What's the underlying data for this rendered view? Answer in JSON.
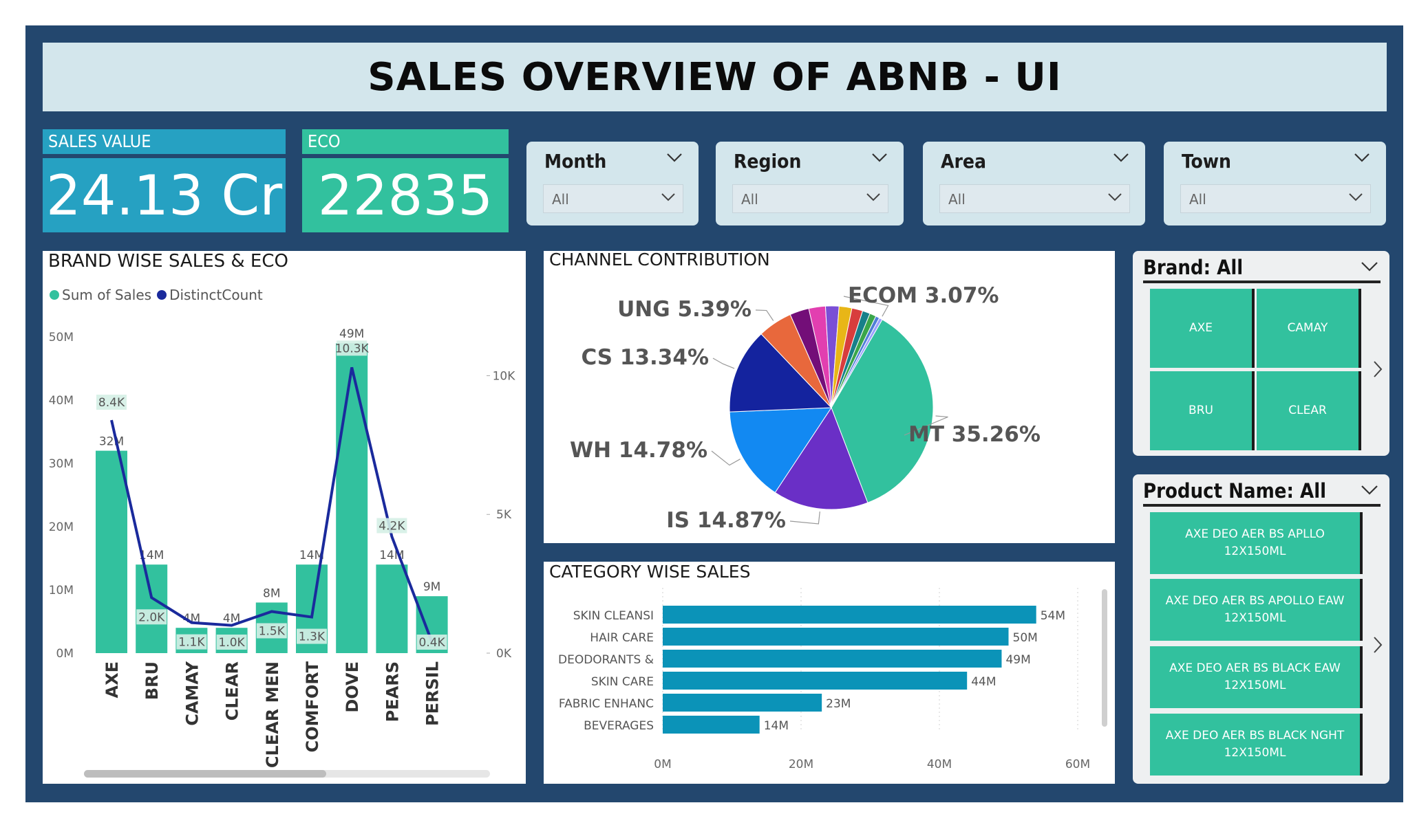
{
  "title": "SALES OVERVIEW OF ABNB - UI",
  "kpis": {
    "sales_label": "SALES VALUE",
    "sales_value": "24.13 Cr",
    "eco_label": "ECO",
    "eco_value": "22835"
  },
  "slicers": [
    {
      "label": "Month",
      "value": "All"
    },
    {
      "label": "Region",
      "value": "All"
    },
    {
      "label": "Area",
      "value": "All"
    },
    {
      "label": "Town",
      "value": "All"
    }
  ],
  "colors": {
    "frame": "#23476e",
    "teal": "#32c19e",
    "navy": "#1a2a9c",
    "kpi_blue": "#26a1c2",
    "bar_blue": "#0b93b8"
  },
  "brand_panel": {
    "title": "Brand: All",
    "tiles": [
      "AXE",
      "CAMAY",
      "BRU",
      "CLEAR"
    ]
  },
  "product_panel": {
    "title": "Product Name: All",
    "tiles": [
      [
        "AXE DEO AER BS APLLO",
        "12X150ML"
      ],
      [
        "AXE DEO AER BS APOLLO EAW",
        "12X150ML"
      ],
      [
        "AXE DEO AER BS BLACK EAW",
        "12X150ML"
      ],
      [
        "AXE DEO AER BS BLACK NGHT",
        "12X150ML"
      ]
    ]
  },
  "chart_data": [
    {
      "id": "brand",
      "type": "bar",
      "title": "BRAND WISE SALES & ECO",
      "legend": [
        "Sum of Sales",
        "DistinctCount"
      ],
      "legend_position": "top-left",
      "categories": [
        "AXE",
        "BRU",
        "CAMAY",
        "CLEAR",
        "CLEAR MEN",
        "COMFORT",
        "DOVE",
        "PEARS",
        "PERSIL"
      ],
      "series": [
        {
          "name": "Sum of Sales",
          "kind": "bar",
          "axis": "left",
          "color": "#32c19e",
          "values": [
            32,
            14,
            4,
            4,
            8,
            14,
            49,
            14,
            9
          ],
          "labels": [
            "32M",
            "14M",
            "4M",
            "4M",
            "8M",
            "14M",
            "49M",
            "14M",
            "9M"
          ]
        },
        {
          "name": "DistinctCount",
          "kind": "line",
          "axis": "right",
          "color": "#1a2a9c",
          "values": [
            8.4,
            2.0,
            1.1,
            1.0,
            1.5,
            1.3,
            10.3,
            4.2,
            0.4
          ],
          "labels": [
            "8.4K",
            "2.0K",
            "1.1K",
            "1.0K",
            "1.5K",
            "1.3K",
            "10.3K",
            "4.2K",
            "0.4K"
          ]
        }
      ],
      "y_left": {
        "ticks": [
          "0M",
          "10M",
          "20M",
          "30M",
          "40M",
          "50M"
        ],
        "range": [
          0,
          50
        ]
      },
      "y_right": {
        "ticks": [
          "0K",
          "5K",
          "10K"
        ],
        "range": [
          0,
          11.4
        ]
      },
      "grid": false
    },
    {
      "id": "channel",
      "type": "pie",
      "title": "CHANNEL CONTRIBUTION",
      "slices": [
        {
          "label": "MT 35.26%",
          "value": 35.26,
          "color": "#32c19e",
          "show": true
        },
        {
          "label": "IS 14.87%",
          "value": 14.87,
          "color": "#6a2fc6",
          "show": true
        },
        {
          "label": "WH 14.78%",
          "value": 14.78,
          "color": "#1289f2",
          "show": true
        },
        {
          "label": "CS 13.34%",
          "value": 13.34,
          "color": "#14239e",
          "show": true
        },
        {
          "label": "UNG 5.39%",
          "value": 5.39,
          "color": "#e8683c",
          "show": true
        },
        {
          "label": "",
          "value": 3.0,
          "color": "#730e78",
          "show": false
        },
        {
          "label": "",
          "value": 2.6,
          "color": "#e23fb0",
          "show": false
        },
        {
          "label": "",
          "value": 2.1,
          "color": "#7a4fd6",
          "show": false
        },
        {
          "label": "",
          "value": 2.0,
          "color": "#e8b617",
          "show": false
        },
        {
          "label": "",
          "value": 1.7,
          "color": "#d83d3d",
          "show": false
        },
        {
          "label": "",
          "value": 1.2,
          "color": "#17808a",
          "show": false
        },
        {
          "label": "",
          "value": 1.0,
          "color": "#3aa64a",
          "show": false
        },
        {
          "label": "",
          "value": 0.6,
          "color": "#4f7fd6",
          "show": false
        },
        {
          "label": "ECOM 3.07%",
          "value": 0.5,
          "color": "#9aa0ff",
          "show": true
        }
      ]
    },
    {
      "id": "category",
      "type": "bar",
      "orientation": "horizontal",
      "title": "CATEGORY WISE SALES",
      "categories": [
        "SKIN CLEANSI",
        "HAIR CARE",
        "DEODORANTS &",
        "SKIN CARE",
        "FABRIC ENHANC",
        "BEVERAGES"
      ],
      "values": [
        54,
        50,
        49,
        44,
        23,
        14
      ],
      "labels": [
        "54M",
        "50M",
        "49M",
        "44M",
        "23M",
        "14M"
      ],
      "x_ticks": [
        "0M",
        "20M",
        "40M",
        "60M"
      ],
      "xlim": [
        0,
        60
      ],
      "color": "#0b93b8",
      "grid": true
    }
  ]
}
